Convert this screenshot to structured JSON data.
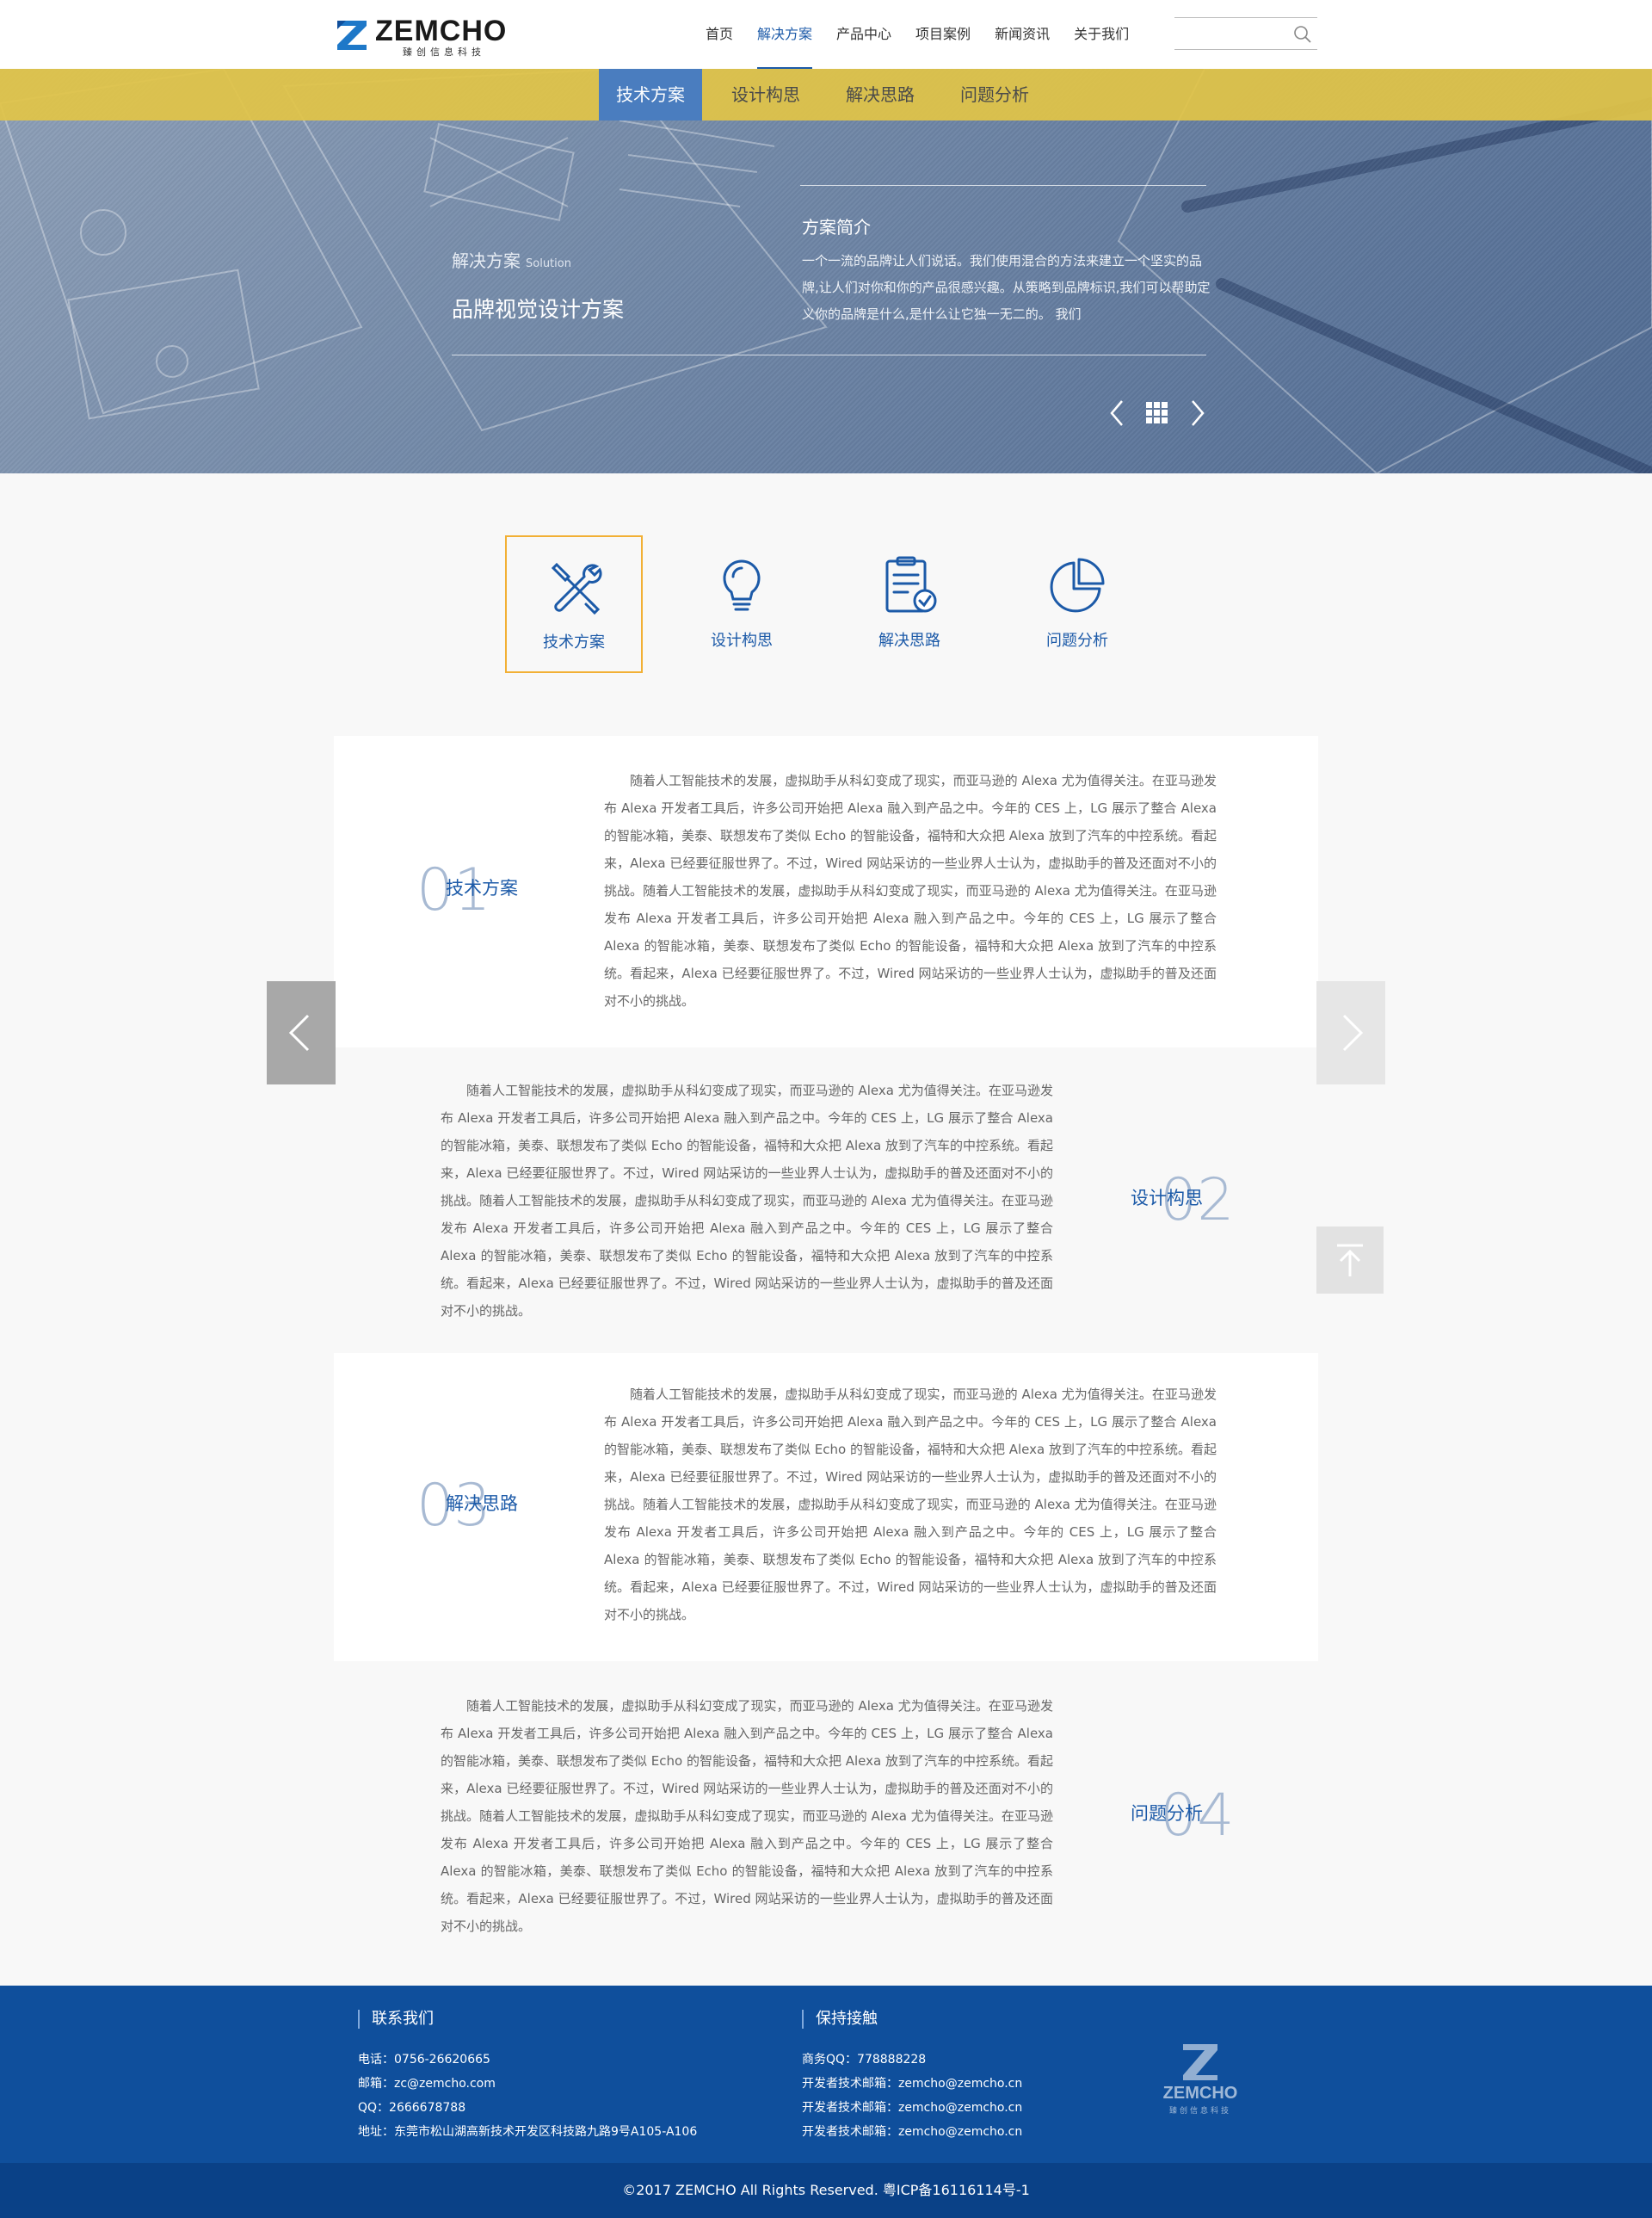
{
  "brand": {
    "name": "ZEMCHO",
    "tagline": "臻创信息科技"
  },
  "nav": {
    "items": [
      "首页",
      "解决方案",
      "产品中心",
      "项目案例",
      "新闻资讯",
      "关于我们"
    ],
    "active_index": 1
  },
  "search": {
    "placeholder": ""
  },
  "subnav": {
    "items": [
      "技术方案",
      "设计构思",
      "解决思路",
      "问题分析"
    ],
    "active_index": 0
  },
  "banner": {
    "category": "解决方案",
    "category_en": "Solution",
    "title": "品牌视觉设计方案",
    "intro_title": "方案简介",
    "intro_text": "一个一流的品牌让人们说话。我们使用混合的方法来建立一个坚实的品牌,让人们对你和你的产品很感兴趣。从策略到品牌标识,我们可以帮助定义你的品牌是什么,是什么让它独一无二的。 我们"
  },
  "tabs": [
    {
      "label": "技术方案",
      "icon": "tools-icon"
    },
    {
      "label": "设计构思",
      "icon": "lightbulb-icon"
    },
    {
      "label": "解决思路",
      "icon": "clipboard-check-icon"
    },
    {
      "label": "问题分析",
      "icon": "pie-chart-icon"
    }
  ],
  "sections": [
    {
      "number": "01",
      "label": "技术方案",
      "text": "随着人工智能技术的发展，虚拟助手从科幻变成了现实，而亚马逊的 Alexa 尤为值得关注。在亚马逊发布 Alexa 开发者工具后，许多公司开始把 Alexa 融入到产品之中。今年的 CES 上，LG 展示了整合 Alexa 的智能冰箱，美泰、联想发布了类似 Echo 的智能设备，福特和大众把 Alexa 放到了汽车的中控系统。看起来，Alexa 已经要征服世界了。不过，Wired 网站采访的一些业界人士认为，虚拟助手的普及还面对不小的挑战。随着人工智能技术的发展，虚拟助手从科幻变成了现实，而亚马逊的 Alexa 尤为值得关注。在亚马逊发布 Alexa 开发者工具后，许多公司开始把 Alexa 融入到产品之中。今年的 CES 上，LG 展示了整合 Alexa 的智能冰箱，美泰、联想发布了类似 Echo 的智能设备，福特和大众把 Alexa 放到了汽车的中控系统。看起来，Alexa 已经要征服世界了。不过，Wired 网站采访的一些业界人士认为，虚拟助手的普及还面对不小的挑战。"
    },
    {
      "number": "02",
      "label": "设计构思",
      "text": "随着人工智能技术的发展，虚拟助手从科幻变成了现实，而亚马逊的 Alexa 尤为值得关注。在亚马逊发布 Alexa 开发者工具后，许多公司开始把 Alexa 融入到产品之中。今年的 CES 上，LG 展示了整合 Alexa 的智能冰箱，美泰、联想发布了类似 Echo 的智能设备，福特和大众把 Alexa 放到了汽车的中控系统。看起来，Alexa 已经要征服世界了。不过，Wired 网站采访的一些业界人士认为，虚拟助手的普及还面对不小的挑战。随着人工智能技术的发展，虚拟助手从科幻变成了现实，而亚马逊的 Alexa 尤为值得关注。在亚马逊发布 Alexa 开发者工具后，许多公司开始把 Alexa 融入到产品之中。今年的 CES 上，LG 展示了整合 Alexa 的智能冰箱，美泰、联想发布了类似 Echo 的智能设备，福特和大众把 Alexa 放到了汽车的中控系统。看起来，Alexa 已经要征服世界了。不过，Wired 网站采访的一些业界人士认为，虚拟助手的普及还面对不小的挑战。"
    },
    {
      "number": "03",
      "label": "解决思路",
      "text": "随着人工智能技术的发展，虚拟助手从科幻变成了现实，而亚马逊的 Alexa 尤为值得关注。在亚马逊发布 Alexa 开发者工具后，许多公司开始把 Alexa 融入到产品之中。今年的 CES 上，LG 展示了整合 Alexa 的智能冰箱，美泰、联想发布了类似 Echo 的智能设备，福特和大众把 Alexa 放到了汽车的中控系统。看起来，Alexa 已经要征服世界了。不过，Wired 网站采访的一些业界人士认为，虚拟助手的普及还面对不小的挑战。随着人工智能技术的发展，虚拟助手从科幻变成了现实，而亚马逊的 Alexa 尤为值得关注。在亚马逊发布 Alexa 开发者工具后，许多公司开始把 Alexa 融入到产品之中。今年的 CES 上，LG 展示了整合 Alexa 的智能冰箱，美泰、联想发布了类似 Echo 的智能设备，福特和大众把 Alexa 放到了汽车的中控系统。看起来，Alexa 已经要征服世界了。不过，Wired 网站采访的一些业界人士认为，虚拟助手的普及还面对不小的挑战。"
    },
    {
      "number": "04",
      "label": "问题分析",
      "text": "随着人工智能技术的发展，虚拟助手从科幻变成了现实，而亚马逊的 Alexa 尤为值得关注。在亚马逊发布 Alexa 开发者工具后，许多公司开始把 Alexa 融入到产品之中。今年的 CES 上，LG 展示了整合 Alexa 的智能冰箱，美泰、联想发布了类似 Echo 的智能设备，福特和大众把 Alexa 放到了汽车的中控系统。看起来，Alexa 已经要征服世界了。不过，Wired 网站采访的一些业界人士认为，虚拟助手的普及还面对不小的挑战。随着人工智能技术的发展，虚拟助手从科幻变成了现实，而亚马逊的 Alexa 尤为值得关注。在亚马逊发布 Alexa 开发者工具后，许多公司开始把 Alexa 融入到产品之中。今年的 CES 上，LG 展示了整合 Alexa 的智能冰箱，美泰、联想发布了类似 Echo 的智能设备，福特和大众把 Alexa 放到了汽车的中控系统。看起来，Alexa 已经要征服世界了。不过，Wired 网站采访的一些业界人士认为，虚拟助手的普及还面对不小的挑战。"
    }
  ],
  "footer": {
    "contact_title": "联系我们",
    "contact_lines": [
      "电话：0756-26620665",
      "邮箱：zc@zemcho.com",
      "QQ：2666678788",
      "地址：东莞市松山湖高新技术开发区科技路九路9号A105-A106"
    ],
    "keep_title": "保持接触",
    "keep_lines": [
      "商务QQ：778888228",
      "开发者技术邮箱：zemcho@zemcho.cn",
      "开发者技术邮箱：zemcho@zemcho.cn",
      "开发者技术邮箱：zemcho@zemcho.cn"
    ],
    "logo_text": "ZEMCHO",
    "logo_sub": "臻创信息科技",
    "copyright": "©2017 ZEMCHO All Rights Reserved.  粤ICP备16116114号-1"
  },
  "colors": {
    "accent": "#1c5aa8",
    "subnav_bg": "#e2c446",
    "active_tab_border": "#f2b035",
    "footer_bg": "#0f4f9c",
    "copyright_bg": "#0a4187"
  }
}
